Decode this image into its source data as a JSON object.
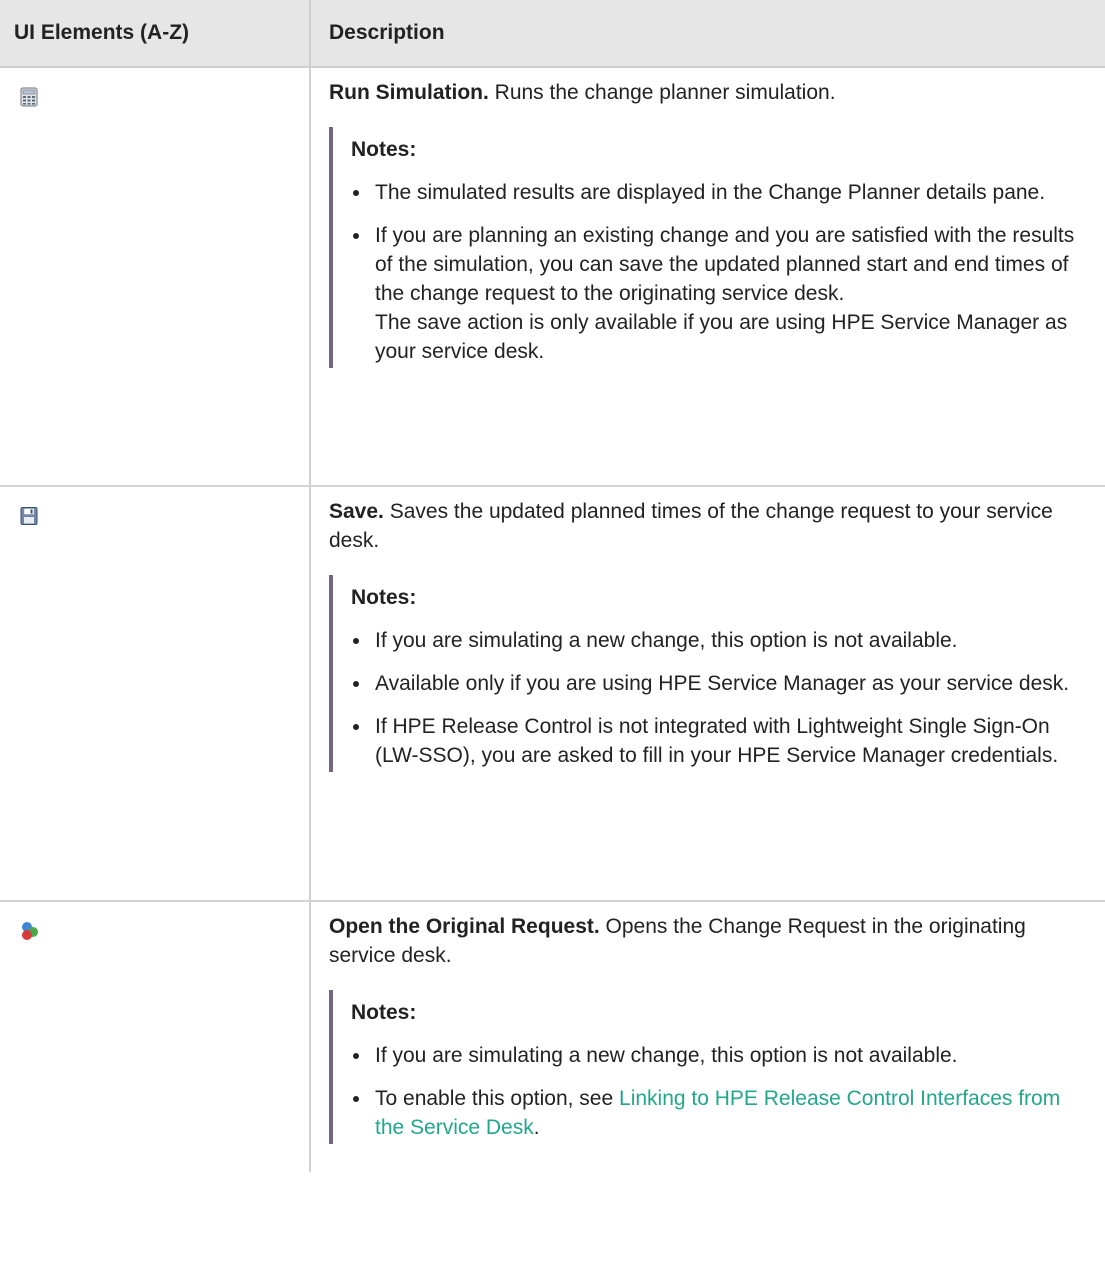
{
  "header": {
    "col_elements": "UI Elements (A-Z)",
    "col_description": "Description"
  },
  "rows": [
    {
      "icon": "calculator-icon",
      "title": "Run Simulation.",
      "text": " Runs the change planner simulation.",
      "notes_label": "Notes:",
      "notes": [
        "The simulated results are displayed in the Change Planner details pane.",
        "If you are planning an existing change and you are satisfied with the results of the simulation, you can save the updated planned start and end times of the change request to the originating service desk."
      ],
      "notes_extra": "The save action is only available if you are using HPE Service Manager as your service desk."
    },
    {
      "icon": "floppy-disk-icon",
      "title": "Save.",
      "text": " Saves the updated planned times of the change request to your service desk.",
      "notes_label": "Notes:",
      "notes": [
        "If you are simulating a new change, this option is not available.",
        "Available only if you are using HPE Service Manager as your service desk.",
        "If HPE Release Control is not integrated with Lightweight Single Sign-On (LW-SSO), you are asked to fill in your HPE Service Manager credentials."
      ]
    },
    {
      "icon": "open-request-icon",
      "title": "Open the Original Request.",
      "text": " Opens the Change Request in the originating service desk.",
      "notes_label": "Notes:",
      "notes": [
        "If you are simulating a new change, this option is not available."
      ],
      "last_note_prefix": "To enable this option, see ",
      "last_note_link": "Linking to HPE Release Control Interfaces from the Service Desk",
      "last_note_suffix": "."
    }
  ],
  "colors": {
    "header_bg": "#e6e6e6",
    "note_bar": "#74667f",
    "link": "#21a88a"
  }
}
